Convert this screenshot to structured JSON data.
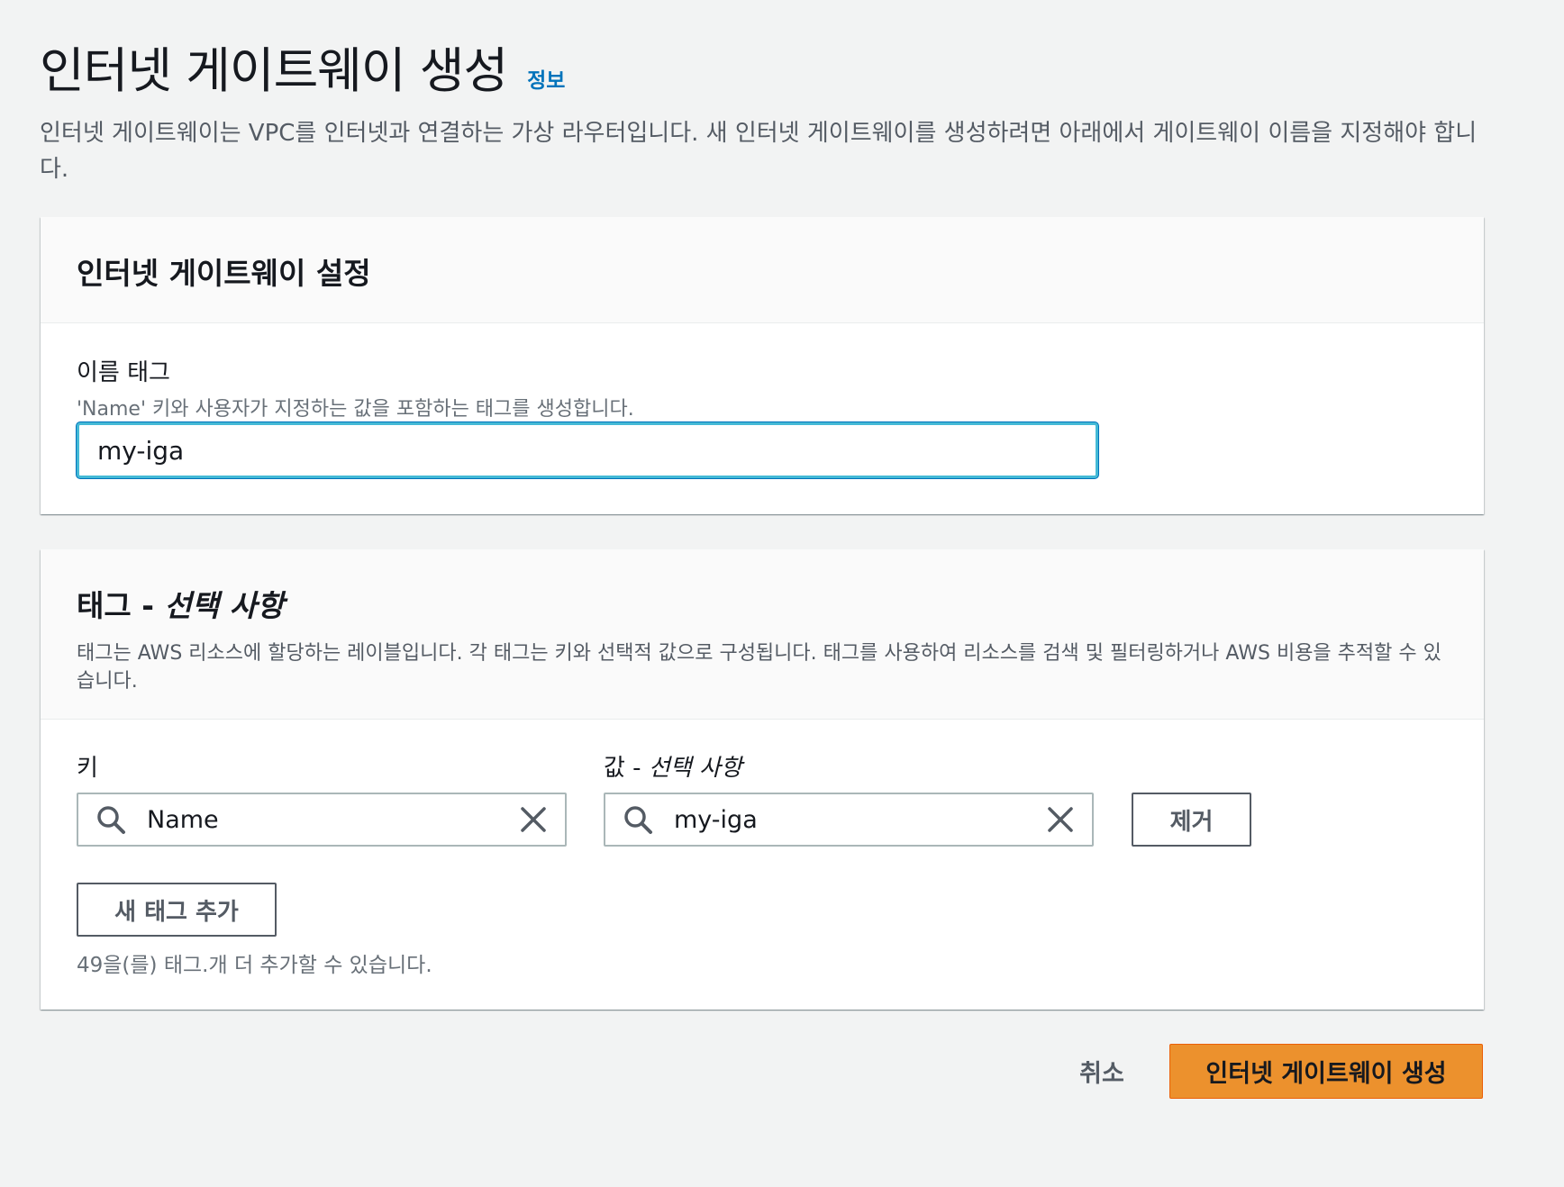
{
  "header": {
    "title": "인터넷 게이트웨이 생성",
    "info_link": "정보",
    "description": "인터넷 게이트웨이는 VPC를 인터넷과 연결하는 가상 라우터입니다. 새 인터넷 게이트웨이를 생성하려면 아래에서 게이트웨이 이름을 지정해야 합니다."
  },
  "settings_panel": {
    "title": "인터넷 게이트웨이 설정",
    "name_tag_label": "이름 태그",
    "name_tag_description": "'Name' 키와 사용자가 지정하는 값을 포함하는 태그를 생성합니다.",
    "name_tag_value": "my-iga"
  },
  "tags_panel": {
    "title_main": "태그 - ",
    "title_optional": "선택 사항",
    "description": "태그는 AWS 리소스에 할당하는 레이블입니다. 각 태그는 키와 선택적 값으로 구성됩니다. 태그를 사용하여 리소스를 검색 및 필터링하거나 AWS 비용을 추적할 수 있습니다.",
    "key_label": "키",
    "value_label_main": "값 - ",
    "value_label_optional": "선택 사항",
    "tag_key": "Name",
    "tag_value": "my-iga",
    "remove_label": "제거",
    "add_tag_label": "새 태그 추가",
    "remaining_text": "49을(를) 태그.개 더 추가할 수 있습니다."
  },
  "footer": {
    "cancel_label": "취소",
    "create_label": "인터넷 게이트웨이 생성"
  },
  "colors": {
    "primary_button": "#ec912d",
    "link": "#0073bb",
    "focus_border": "#44b9d6"
  },
  "icons": [
    "search-icon",
    "close-icon"
  ]
}
